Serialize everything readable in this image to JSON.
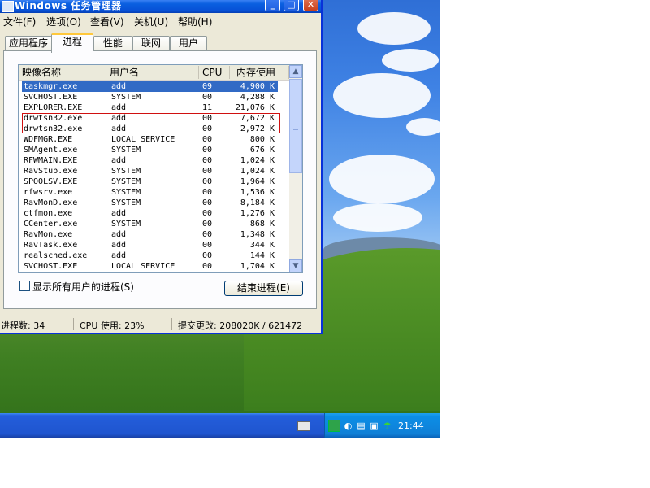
{
  "window": {
    "title": "Windows 任务管理器",
    "controls": {
      "minimize": "_",
      "maximize": "□",
      "close": "✕"
    }
  },
  "menu": [
    "文件(F)",
    "选项(O)",
    "查看(V)",
    "关机(U)",
    "帮助(H)"
  ],
  "tabs": [
    {
      "label": "应用程序",
      "active": false
    },
    {
      "label": "进程",
      "active": true
    },
    {
      "label": "性能",
      "active": false
    },
    {
      "label": "联网",
      "active": false
    },
    {
      "label": "用户",
      "active": false
    }
  ],
  "columns": {
    "name": "映像名称",
    "user": "用户名",
    "cpu": "CPU",
    "mem": "内存使用"
  },
  "processes": [
    {
      "name": "taskmgr.exe",
      "user": "add",
      "cpu": "09",
      "mem": "4,900 K",
      "selected": true
    },
    {
      "name": "SVCHOST.EXE",
      "user": "SYSTEM",
      "cpu": "00",
      "mem": "4,288 K"
    },
    {
      "name": "EXPLORER.EXE",
      "user": "add",
      "cpu": "11",
      "mem": "21,076 K"
    },
    {
      "name": "drwtsn32.exe",
      "user": "add",
      "cpu": "00",
      "mem": "7,672 K"
    },
    {
      "name": "drwtsn32.exe",
      "user": "add",
      "cpu": "00",
      "mem": "2,972 K"
    },
    {
      "name": "WDFMGR.EXE",
      "user": "LOCAL SERVICE",
      "cpu": "00",
      "mem": "800 K"
    },
    {
      "name": "SMAgent.exe",
      "user": "SYSTEM",
      "cpu": "00",
      "mem": "676 K"
    },
    {
      "name": "RFWMAIN.EXE",
      "user": "add",
      "cpu": "00",
      "mem": "1,024 K"
    },
    {
      "name": "RavStub.exe",
      "user": "SYSTEM",
      "cpu": "00",
      "mem": "1,024 K"
    },
    {
      "name": "SPOOLSV.EXE",
      "user": "SYSTEM",
      "cpu": "00",
      "mem": "1,964 K"
    },
    {
      "name": "rfwsrv.exe",
      "user": "SYSTEM",
      "cpu": "00",
      "mem": "1,536 K"
    },
    {
      "name": "RavMonD.exe",
      "user": "SYSTEM",
      "cpu": "00",
      "mem": "8,184 K"
    },
    {
      "name": "ctfmon.exe",
      "user": "add",
      "cpu": "00",
      "mem": "1,276 K"
    },
    {
      "name": "CCenter.exe",
      "user": "SYSTEM",
      "cpu": "00",
      "mem": "868 K"
    },
    {
      "name": "RavMon.exe",
      "user": "add",
      "cpu": "00",
      "mem": "1,348 K"
    },
    {
      "name": "RavTask.exe",
      "user": "add",
      "cpu": "00",
      "mem": "344 K"
    },
    {
      "name": "realsched.exe",
      "user": "add",
      "cpu": "00",
      "mem": "144 K"
    },
    {
      "name": "SVCHOST.EXE",
      "user": "LOCAL SERVICE",
      "cpu": "00",
      "mem": "1,704 K"
    }
  ],
  "show_all_users": {
    "label": "显示所有用户的进程(S)",
    "checked": false
  },
  "end_process_label": "结束进程(E)",
  "status": {
    "processes": "进程数: 34",
    "cpu": "CPU 使用: 23%",
    "commit": "提交更改: 208020K / 621472"
  },
  "tray": {
    "clock": "21:44"
  },
  "icons": [
    "minimize-icon",
    "maximize-icon",
    "close-icon",
    "taskmgr-window-icon",
    "scroll-up-icon",
    "scroll-down-icon",
    "keyboard-icon",
    "tray-icons"
  ]
}
